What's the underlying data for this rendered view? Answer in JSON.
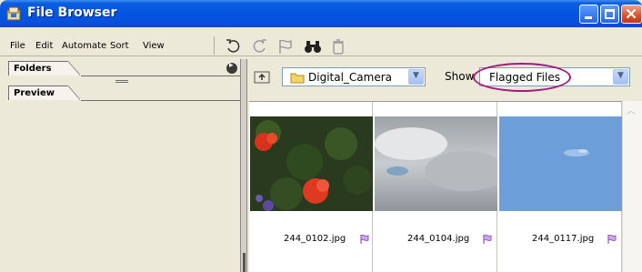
{
  "window": {
    "title": "File Browser",
    "controls": [
      "minimize",
      "maximize",
      "close"
    ]
  },
  "menu": {
    "items": [
      "File",
      "Edit",
      "Automate",
      "Sort",
      "View"
    ]
  },
  "toolbar": {
    "icons": [
      "rotate-ccw-icon",
      "rotate-cw-icon",
      "flag-icon",
      "binoculars-icon",
      "trash-icon"
    ]
  },
  "left_panel": {
    "tabs": [
      "Folders",
      "Preview"
    ]
  },
  "location": {
    "folder": "Digital_Camera",
    "show_label": "Show",
    "show_value": "Flagged Files"
  },
  "thumbnails": [
    {
      "name": "244_0102.jpg",
      "flagged": true,
      "subject": "red flowers"
    },
    {
      "name": "244_0104.jpg",
      "flagged": true,
      "subject": "cloudy sky"
    },
    {
      "name": "244_0117.jpg",
      "flagged": true,
      "subject": "blue sky"
    }
  ],
  "colors": {
    "titlebar": "#0554e0",
    "highlight_oval": "#a01c7c",
    "flag": "#9a5fc6"
  }
}
